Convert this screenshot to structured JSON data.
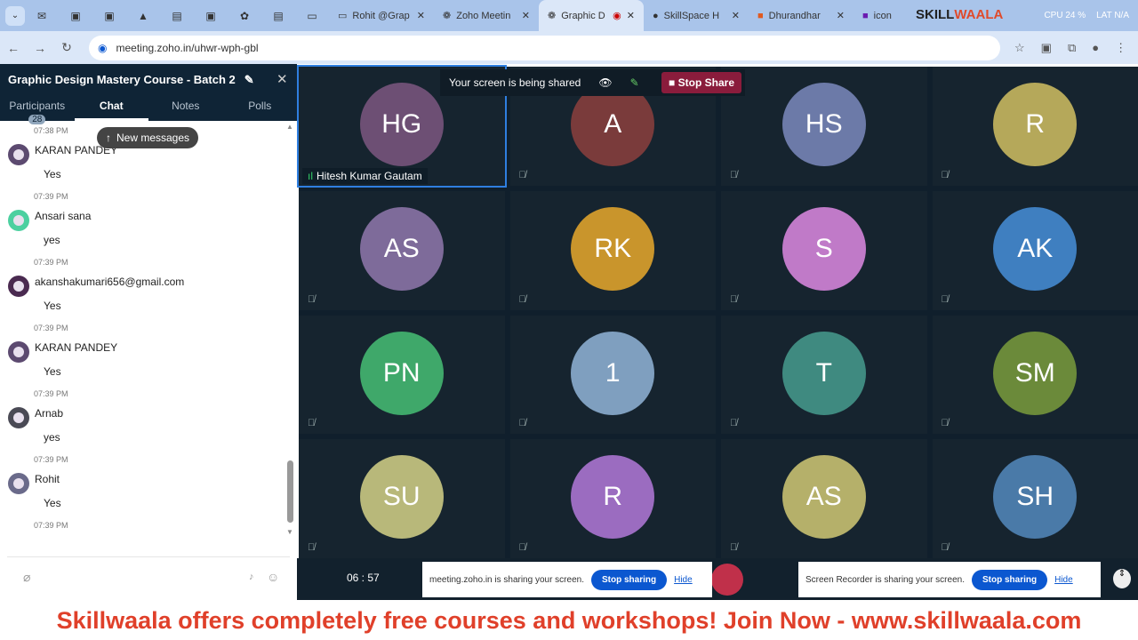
{
  "browser": {
    "tabs": [
      {
        "title": "Rohit @Grap"
      },
      {
        "title": "Zoho Meetin"
      },
      {
        "title": "Graphic D",
        "active": true
      },
      {
        "title": "SkillSpace H"
      },
      {
        "title": "Dhurandhar"
      },
      {
        "title": "icon"
      }
    ],
    "status": {
      "cpu": "CPU 24 %",
      "lat": "LAT N/A"
    },
    "logo": {
      "a": "SKILL",
      "b": "WAALA"
    },
    "url": "meeting.zoho.in/uhwr-wph-gbl"
  },
  "sidebar": {
    "title": "Graphic Design Mastery Course - Batch 2",
    "tabs": [
      {
        "label": "Participants",
        "badge": "28"
      },
      {
        "label": "Chat"
      },
      {
        "label": "Notes"
      },
      {
        "label": "Polls"
      }
    ],
    "new_messages": "New messages",
    "first_ts": "07:38 PM",
    "messages": [
      {
        "name": "KARAN PANDEY",
        "text": "Yes",
        "ts": "07:39 PM",
        "color": "#5c4a70"
      },
      {
        "name": "Ansari sana",
        "text": "yes",
        "ts": "07:39 PM",
        "color": "#4cd0a0"
      },
      {
        "name": "akanshakumari656@gmail.com",
        "text": "Yes",
        "ts": "07:39 PM",
        "color": "#4a2a50"
      },
      {
        "name": "KARAN PANDEY",
        "text": "Yes",
        "ts": "07:39 PM",
        "color": "#5c4a70"
      },
      {
        "name": "Arnab",
        "text": "yes",
        "ts": "07:39 PM",
        "color": "#4a4a55"
      },
      {
        "name": "Rohit",
        "text": "Yes",
        "ts": "07:39 PM",
        "color": "#6a6a8a"
      }
    ]
  },
  "share": {
    "label": "Your screen is being shared",
    "stop": "Stop Share"
  },
  "speaker": "Hitesh Kumar Gautam",
  "participants": [
    {
      "i": "HG",
      "c": "#6d4f74"
    },
    {
      "i": "A",
      "c": "#7a3b3b"
    },
    {
      "i": "HS",
      "c": "#6c7aa8"
    },
    {
      "i": "R",
      "c": "#b5a85a"
    },
    {
      "i": "AS",
      "c": "#7e6b9a"
    },
    {
      "i": "RK",
      "c": "#c9952c"
    },
    {
      "i": "S",
      "c": "#c07ac8"
    },
    {
      "i": "AK",
      "c": "#3f7fc0"
    },
    {
      "i": "PN",
      "c": "#3fa86a"
    },
    {
      "i": "1",
      "c": "#7f9fbf"
    },
    {
      "i": "T",
      "c": "#3f8a80"
    },
    {
      "i": "SM",
      "c": "#6b8a3a"
    },
    {
      "i": "SU",
      "c": "#b8b87a"
    },
    {
      "i": "R",
      "c": "#9b6cc0"
    },
    {
      "i": "AS",
      "c": "#b5b06a"
    },
    {
      "i": "SH",
      "c": "#4a7aa8"
    }
  ],
  "bottom": {
    "timer": "06 : 57",
    "pop1": {
      "text": "meeting.zoho.in is sharing your screen.",
      "stop": "Stop sharing",
      "hide": "Hide"
    },
    "pop2": {
      "text": "Screen Recorder is sharing your screen.",
      "stop": "Stop sharing",
      "hide": "Hide"
    }
  },
  "banner": "Skillwaala offers completely free courses and workshops! Join Now  - www.skillwaala.com"
}
